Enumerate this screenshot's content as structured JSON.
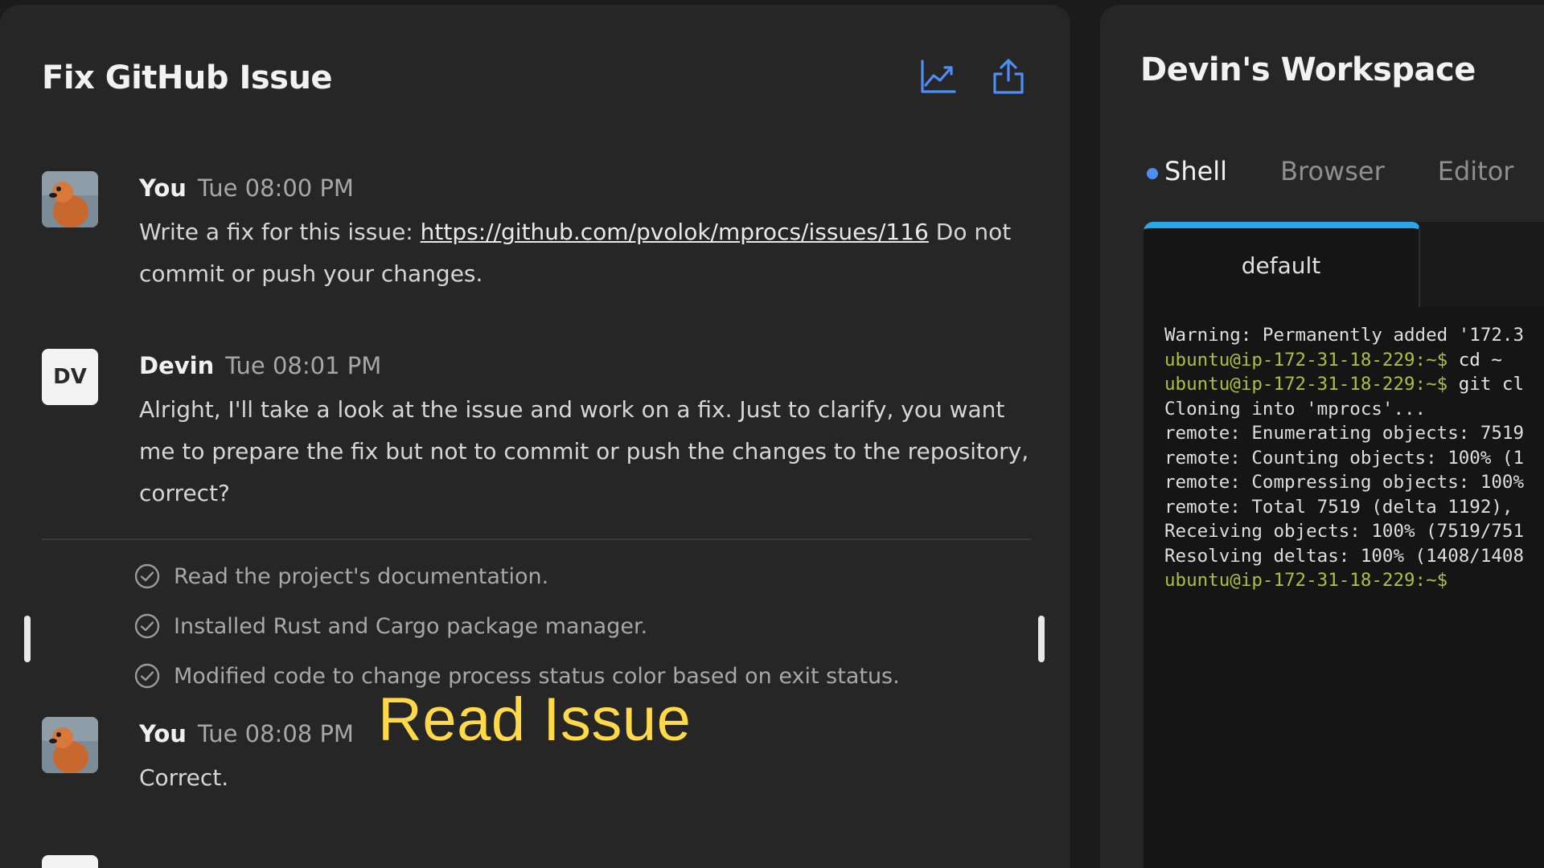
{
  "chat": {
    "title": "Fix GitHub Issue",
    "header_icons": [
      "chart-icon",
      "share-icon"
    ],
    "messages": [
      {
        "author": "You",
        "time": "Tue 08:00 PM",
        "avatar": "user-avatar",
        "text_before": "Write a fix for this issue: ",
        "link": "https://github.com/pvolok/mprocs/issues/116",
        "text_after": " Do not commit or push your changes."
      },
      {
        "author": "Devin",
        "time": "Tue 08:01 PM",
        "avatar_initials": "DV",
        "text": "Alright, I'll take a look at the issue and work on a fix. Just to clarify, you want me to prepare the fix but not to commit or push the changes to the repository, correct?"
      },
      {
        "author": "You",
        "time": "Tue 08:08 PM",
        "avatar": "user-avatar",
        "text": "Correct."
      }
    ],
    "tasks": [
      "Read the project's documentation.",
      "Installed Rust and Cargo package manager.",
      "Modified code to change process status color based on exit status."
    ]
  },
  "overlay_caption": "Read Issue",
  "workspace": {
    "title": "Devin's Workspace",
    "tabs": [
      "Shell",
      "Browser",
      "Editor"
    ],
    "active_tab": "Shell",
    "terminal": {
      "tab_label": "default",
      "lines": [
        {
          "kind": "text",
          "text": "Warning: Permanently added '172.3"
        },
        {
          "kind": "prompt",
          "prompt": "ubuntu@ip-172-31-18-229:~$",
          "cmd": " cd ~"
        },
        {
          "kind": "prompt",
          "prompt": "ubuntu@ip-172-31-18-229:~$",
          "cmd": " git cl"
        },
        {
          "kind": "text",
          "text": "Cloning into 'mprocs'..."
        },
        {
          "kind": "text",
          "text": "remote: Enumerating objects: 7519"
        },
        {
          "kind": "text",
          "text": "remote: Counting objects: 100% (1"
        },
        {
          "kind": "text",
          "text": "remote: Compressing objects: 100%"
        },
        {
          "kind": "text",
          "text": "remote: Total 7519 (delta 1192),"
        },
        {
          "kind": "text",
          "text": "Receiving objects: 100% (7519/751"
        },
        {
          "kind": "text",
          "text": "Resolving deltas: 100% (1408/1408"
        },
        {
          "kind": "prompt",
          "prompt": "ubuntu@ip-172-31-18-229:~$",
          "cmd": ""
        }
      ]
    }
  },
  "colors": {
    "accent_blue": "#29a7ea",
    "tab_dot": "#4d8ef8",
    "prompt_green": "#a9c23c",
    "caption_yellow": "#ffd948"
  }
}
